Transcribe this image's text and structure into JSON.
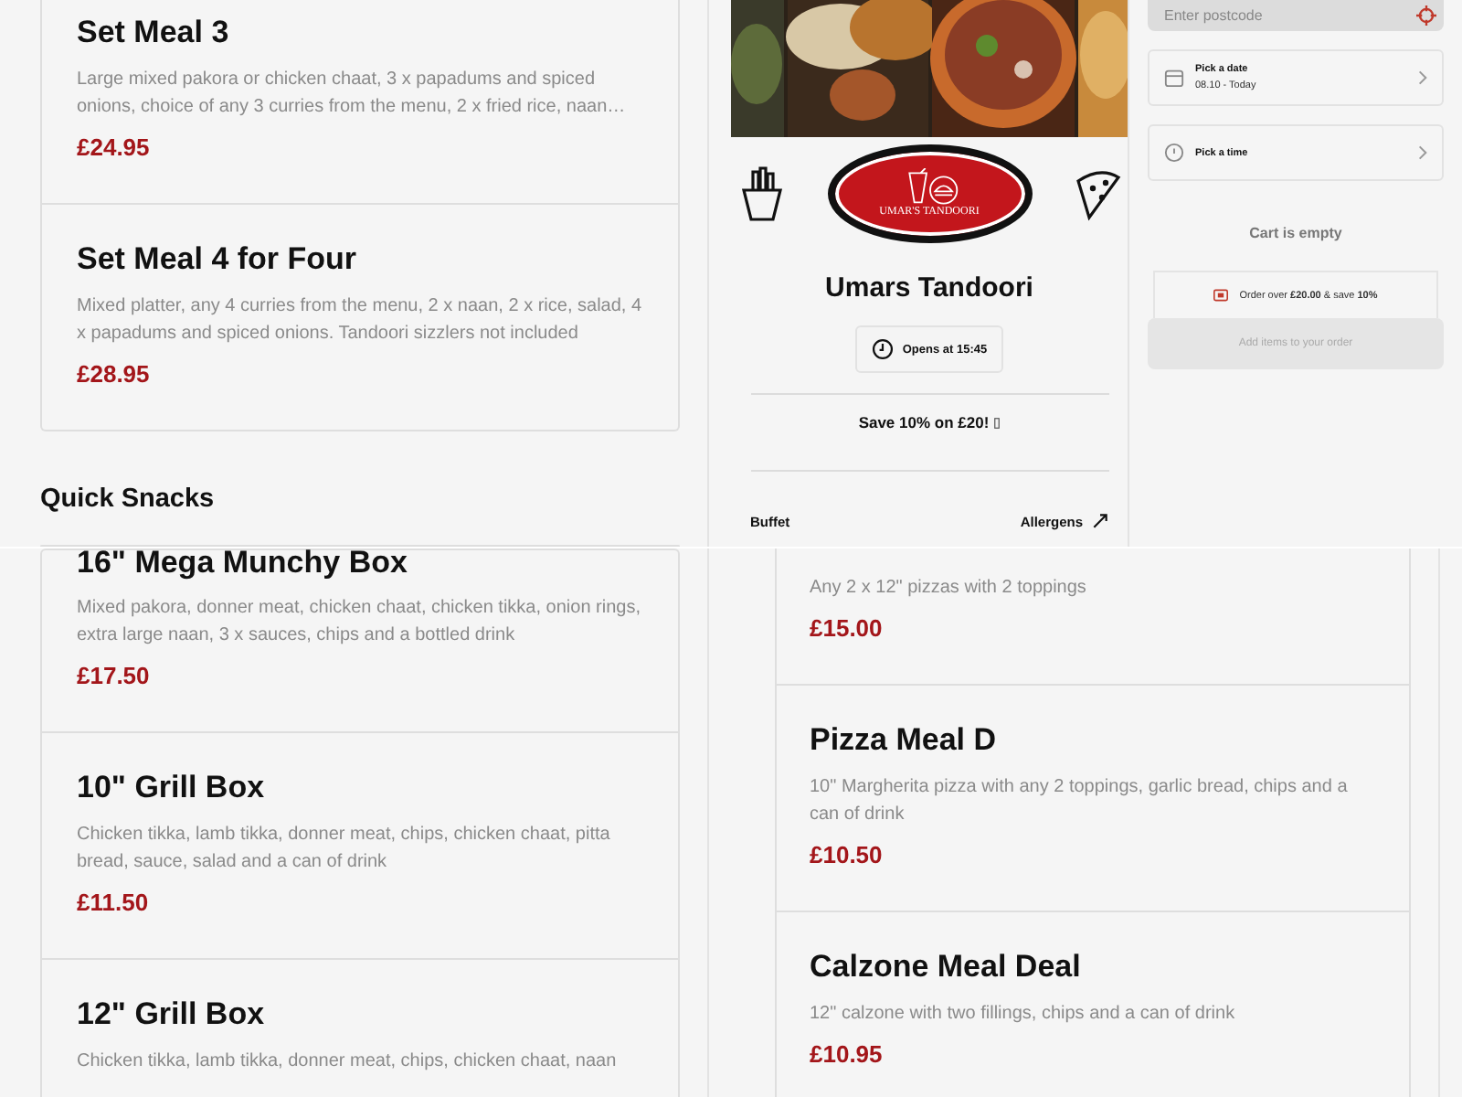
{
  "top_left": {
    "items": [
      {
        "title": "Set Meal 3",
        "description": "Large mixed pakora or chicken chaat, 3 x papadums and spiced onions, choice of any 3 curries from the menu, 2 x fried rice, naan…",
        "price": "£24.95"
      },
      {
        "title": "Set Meal 4 for Four",
        "description": "Mixed platter, any 4 curries from the menu, 2 x naan, 2 x rice, salad, 4 x papadums and spiced onions. Tandoori sizzlers not included",
        "price": "£28.95"
      }
    ],
    "section_title": "Quick Snacks"
  },
  "restaurant": {
    "logo_text": "UMAR'S TANDOORI",
    "name": "Umars Tandoori",
    "hours": "Opens at 15:45",
    "promo": "Save 10% on £20!",
    "category": "Buffet",
    "allergens": "Allergens"
  },
  "order": {
    "postcode": {
      "placeholder": "Enter postcode"
    },
    "date": {
      "label": "Pick a date",
      "value": "08.10 - Today"
    },
    "time": {
      "label": "Pick a time"
    },
    "cart_status": "Cart is empty",
    "offer": "Order over **£20.00** & save **10%**",
    "checkout": {
      "label": "Add items to your order",
      "disabled": true
    }
  },
  "bottom_left": {
    "items": [
      {
        "title": "16\" Mega Munchy Box",
        "description": "Mixed pakora, donner meat, chicken chaat, chicken tikka, onion rings, extra large naan, 3 x sauces, chips and a bottled drink",
        "price": "£17.50"
      },
      {
        "title": "10\" Grill Box",
        "description": "Chicken tikka, lamb tikka, donner meat, chips, chicken chaat, pitta bread, sauce, salad and a can of drink",
        "price": "£11.50"
      },
      {
        "title": "12\" Grill Box",
        "description": "Chicken tikka, lamb tikka, donner meat, chips, chicken chaat, naan"
      }
    ]
  },
  "bottom_right": {
    "items": [
      {
        "description": "Any 2 x 12\" pizzas with 2 toppings",
        "price": "£15.00"
      },
      {
        "title": "Pizza Meal D",
        "description": "10\" Margherita pizza with any 2 toppings, garlic bread, chips and a can of drink",
        "price": "£10.50"
      },
      {
        "title": "Calzone Meal Deal",
        "description": "12\" calzone with two fillings, chips and a can of drink",
        "price": "£10.95"
      }
    ]
  }
}
